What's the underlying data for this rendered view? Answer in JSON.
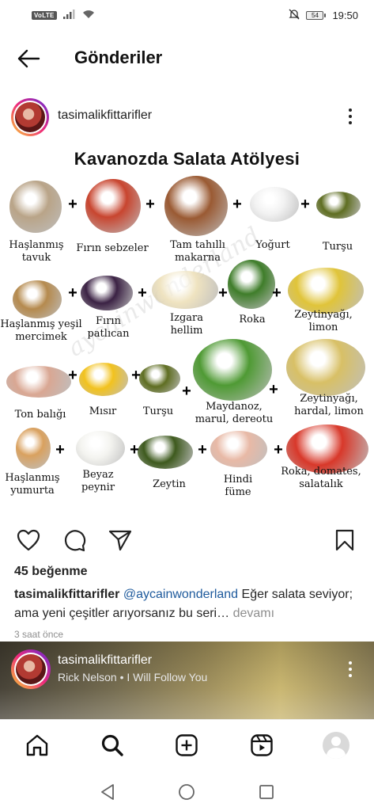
{
  "status_bar": {
    "network_badge": "VoLTE",
    "battery_level": "54",
    "time": "19:50"
  },
  "header": {
    "title": "Gönderiler"
  },
  "post": {
    "username": "tasimalikfittarifler",
    "image": {
      "title": "Kavanozda Salata Atölyesi",
      "watermark": "aycainwonderland",
      "items": [
        {
          "label": "Haşlanmış tavuk",
          "color": "#b9a488"
        },
        {
          "label": "Fırın sebzeler",
          "color": "#c8452f"
        },
        {
          "label": "Tam tahıllı makarna",
          "color": "#9a5a33"
        },
        {
          "label": "Yoğurt",
          "color": "#f2f2f2"
        },
        {
          "label": "Turşu",
          "color": "#5f6e22"
        },
        {
          "label": "Haşlanmış yeşil mercimek",
          "color": "#b58a4e"
        },
        {
          "label": "Fırın patlıcan",
          "color": "#3b2244"
        },
        {
          "label": "Izgara hellim",
          "color": "#efe3c0"
        },
        {
          "label": "Roka",
          "color": "#3f7d2a"
        },
        {
          "label": "Zeytinyağı, limon",
          "color": "#e0c43a"
        },
        {
          "label": "Ton balığı",
          "color": "#d9a793"
        },
        {
          "label": "Mısır",
          "color": "#f2c21e"
        },
        {
          "label": "Turşu",
          "color": "#5f6e22"
        },
        {
          "label": "Maydanoz, marul, dereotu",
          "color": "#4f9a34"
        },
        {
          "label": "Zeytinyağı, hardal, limon",
          "color": "#d8c066"
        },
        {
          "label": "Haşlanmış yumurta",
          "color": "#d9a15f"
        },
        {
          "label": "Beyaz peynir",
          "color": "#f4f4f0"
        },
        {
          "label": "Zeytin",
          "color": "#3e5a1e"
        },
        {
          "label": "Hindi füme",
          "color": "#e8b9a6"
        },
        {
          "label": "Roka, domates, salatalık",
          "color": "#d8382a"
        }
      ]
    },
    "likes": "45 beğenme",
    "caption": {
      "username": "tasimalikfittarifler",
      "mention": "@aycainwonderland",
      "text": "Eğer salata seviyor; ama yeni çeşitler arıyorsanız bu seri…",
      "more": "devamı"
    },
    "timestamp": "3 saat önce"
  },
  "next_post": {
    "username": "tasimalikfittarifler",
    "music": "Rick Nelson • I Will Follow You"
  },
  "icons": {
    "back": "arrow-left-icon",
    "more": "more-vertical-icon",
    "like": "heart-icon",
    "comment": "comment-icon",
    "share": "send-icon",
    "save": "bookmark-icon",
    "home": "home-icon",
    "search": "search-icon",
    "create": "plus-square-icon",
    "reels": "reels-icon",
    "profile": "avatar-icon"
  }
}
